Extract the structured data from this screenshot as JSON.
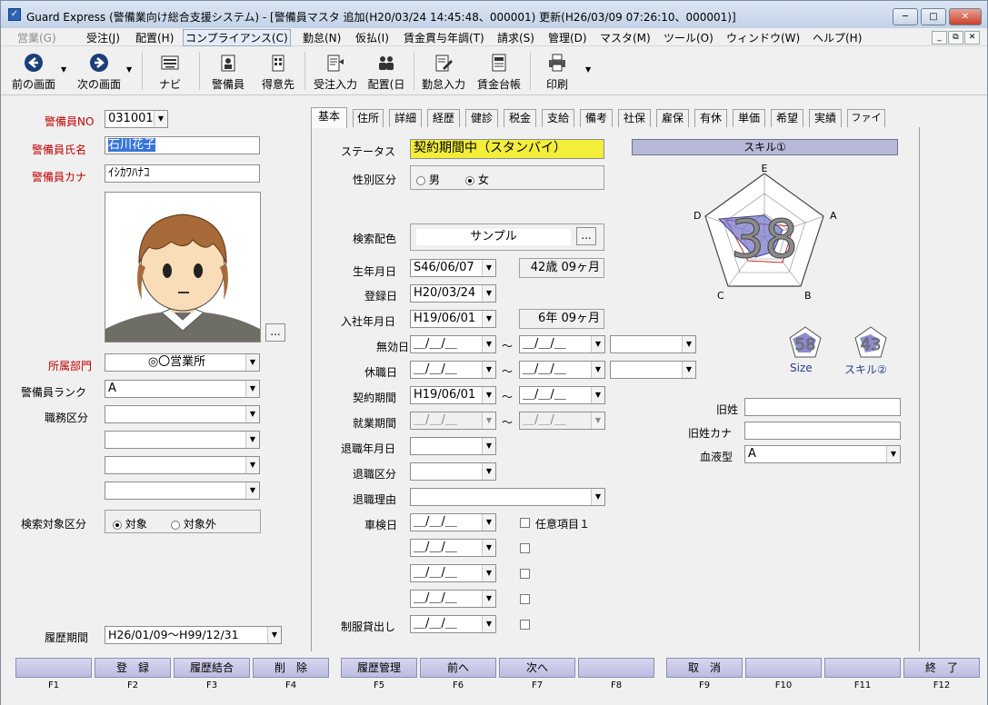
{
  "window": {
    "app_icon": "app-icon",
    "title": "Guard Express (警備業向け総合支援システム) - [警備員マスタ 追加(H20/03/24 14:45:48、000001) 更新(H26/03/09 07:26:10、000001)]",
    "minimize": "─",
    "maximize": "□",
    "close": "✕"
  },
  "menu": {
    "items": [
      "営業(G)",
      "受注(J)",
      "配置(H)",
      "コンプライアンス(C)",
      "勤怠(N)",
      "仮払(I)",
      "賃金貫与年調(T)",
      "請求(S)",
      "管理(D)",
      "マスタ(M)",
      "ツール(O)",
      "ウィンドウ(W)",
      "ヘルプ(H)"
    ],
    "mdi": [
      "_",
      "⧉",
      "✕"
    ]
  },
  "toolbar": {
    "back": "前の画面",
    "forward": "次の画面",
    "navi": "ナビ",
    "guard": "警備員",
    "client": "得意先",
    "order_entry": "受注入力",
    "placement": "配置(日",
    "attendance": "勤怠入力",
    "ledger": "賃金台帳",
    "print": "印刷"
  },
  "left": {
    "guard_no_label": "警備員NO",
    "guard_no": "031001",
    "name_label": "警備員氏名",
    "name": "石川花子",
    "kana_label": "警備員カナ",
    "kana": "ｲｼｶﾜﾊﾅｺ",
    "photo_btn": "...",
    "dept_label": "所属部門",
    "dept": "◎〇営業所",
    "rank_label": "警備員ランク",
    "rank": "A",
    "duty_label": "職務区分",
    "search_label": "検索対象区分",
    "search_on": "対象",
    "search_off": "対象外",
    "history_label": "履歴期間",
    "history": "H26/01/09～H99/12/31"
  },
  "tabs": [
    "基本",
    "住所",
    "詳細",
    "経歴",
    "健診",
    "税金",
    "支給",
    "備考",
    "社保",
    "雇保",
    "有休",
    "単価",
    "希望",
    "実績",
    "ファイル"
  ],
  "basic": {
    "status_label": "ステータス",
    "status": "契約期間中（スタンバイ）",
    "gender_label": "性別区分",
    "male": "男",
    "female": "女",
    "color_label": "検索配色",
    "color_value": "サンプル",
    "color_btn": "...",
    "birth_label": "生年月日",
    "birth": "S46/06/07",
    "age": "42歳 09ヶ月",
    "reg_label": "登録日",
    "reg": "H20/03/24",
    "join_label": "入社年月日",
    "join": "H19/06/01",
    "tenure": "6年 09ヶ月",
    "invalid_label": "無効日",
    "leave_label": "休職日",
    "contract_label": "契約期間",
    "contract_from": "H19/06/01",
    "work_label": "就業期間",
    "retire_date_label": "退職年月日",
    "retire_type_label": "退職区分",
    "retire_reason_label": "退職理由",
    "inspection_label": "車検日",
    "optional_label": "任意項目１",
    "uniform_label": "制服貸出し",
    "empty_date": "＿/＿/＿",
    "tilde": "～"
  },
  "skill": {
    "header": "スキル①",
    "score": "38",
    "axes": [
      "E",
      "A",
      "B",
      "C",
      "D"
    ],
    "mini1_score": "58",
    "mini1_label": "Size",
    "mini2_score": "43",
    "mini2_label": "スキル②"
  },
  "right": {
    "old_name_label": "旧姓",
    "old_kana_label": "旧姓カナ",
    "blood_label": "血液型",
    "blood": "A"
  },
  "fkeys": [
    {
      "label": "",
      "key": "F1"
    },
    {
      "label": "登　録",
      "key": "F2"
    },
    {
      "label": "履歴結合",
      "key": "F3"
    },
    {
      "label": "削　除",
      "key": "F4"
    },
    {
      "label": "履歴管理",
      "key": "F5"
    },
    {
      "label": "前へ",
      "key": "F6"
    },
    {
      "label": "次へ",
      "key": "F7"
    },
    {
      "label": "",
      "key": "F8"
    },
    {
      "label": "取　消",
      "key": "F9"
    },
    {
      "label": "",
      "key": "F10"
    },
    {
      "label": "",
      "key": "F11"
    },
    {
      "label": "終　了",
      "key": "F12"
    }
  ],
  "colors": {
    "status_bg": "#f2ee3a",
    "skill_header": "#b8b8d8",
    "fkey": "#c8c8e8",
    "label_red": "#c00000"
  }
}
